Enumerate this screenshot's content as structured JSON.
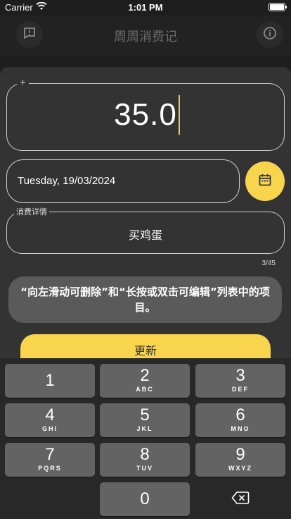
{
  "status_bar": {
    "carrier": "Carrier",
    "time": "1:01 PM"
  },
  "nav": {
    "title": "周周消费记",
    "left_icon": "feedback-icon",
    "right_icon": "info-icon"
  },
  "form": {
    "amount_legend": "+",
    "amount_value": "35.0",
    "date_value": "Tuesday, 19/03/2024",
    "calendar_icon": "calendar-icon",
    "description_legend": "消费详情",
    "description_value": "买鸡蛋",
    "char_counter": "3/45"
  },
  "toast": {
    "message": "“向左滑动可删除”和“长按或双击可编辑”列表中的项目。"
  },
  "update_button": {
    "label": "更新"
  },
  "keyboard": {
    "keys": [
      {
        "num": "1",
        "letters": ""
      },
      {
        "num": "2",
        "letters": "ABC"
      },
      {
        "num": "3",
        "letters": "DEF"
      },
      {
        "num": "4",
        "letters": "GHI"
      },
      {
        "num": "5",
        "letters": "JKL"
      },
      {
        "num": "6",
        "letters": "MNO"
      },
      {
        "num": "7",
        "letters": "PQRS"
      },
      {
        "num": "8",
        "letters": "TUV"
      },
      {
        "num": "9",
        "letters": "WXYZ"
      },
      {
        "num": "0",
        "letters": ""
      }
    ],
    "delete_icon": "backspace-icon"
  },
  "colors": {
    "accent": "#f9d54e",
    "sheet": "#333333",
    "key": "#636363"
  }
}
